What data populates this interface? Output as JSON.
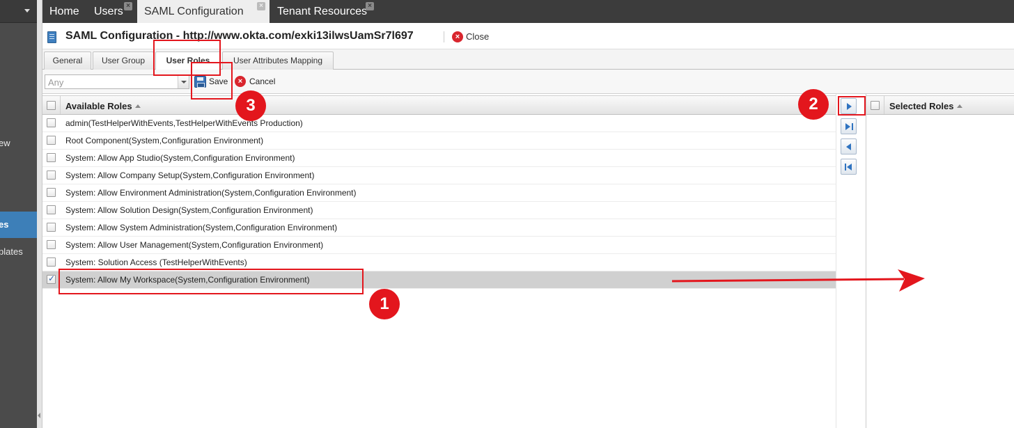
{
  "sidebar": {
    "items": [
      {
        "label": "ew"
      },
      {
        "label": "es"
      },
      {
        "label": "plates"
      }
    ]
  },
  "top_tabs": [
    {
      "label": "Home",
      "closable": false
    },
    {
      "label": "Users",
      "closable": true
    },
    {
      "label": "SAML Configuration",
      "closable": true,
      "active": true
    },
    {
      "label": "Tenant Resources",
      "closable": true
    }
  ],
  "page": {
    "title": "SAML Configuration - http://www.okta.com/exki13ilwsUamSr7l697",
    "close_label": "Close"
  },
  "sub_tabs": [
    {
      "label": "General"
    },
    {
      "label": "User Group"
    },
    {
      "label": "User Roles",
      "active": true
    },
    {
      "label": "User Attributes Mapping"
    }
  ],
  "toolbar": {
    "filter_value": "Any",
    "save_label": "Save",
    "cancel_label": "Cancel"
  },
  "available_roles": {
    "header": "Available Roles",
    "rows": [
      {
        "label": "admin(TestHelperWithEvents,TestHelperWithEvents Production)",
        "checked": false
      },
      {
        "label": "Root Component(System,Configuration Environment)",
        "checked": false
      },
      {
        "label": "System: Allow App Studio(System,Configuration Environment)",
        "checked": false
      },
      {
        "label": "System: Allow Company Setup(System,Configuration Environment)",
        "checked": false
      },
      {
        "label": "System: Allow Environment Administration(System,Configuration Environment)",
        "checked": false
      },
      {
        "label": "System: Allow Solution Design(System,Configuration Environment)",
        "checked": false
      },
      {
        "label": "System: Allow System Administration(System,Configuration Environment)",
        "checked": false
      },
      {
        "label": "System: Allow User Management(System,Configuration Environment)",
        "checked": false
      },
      {
        "label": "System: Solution Access (TestHelperWithEvents)",
        "checked": false
      },
      {
        "label": "System: Allow My Workspace(System,Configuration Environment)",
        "checked": true
      }
    ]
  },
  "selected_roles": {
    "header": "Selected Roles"
  },
  "annotations": {
    "step1": "1",
    "step2": "2",
    "step3": "3",
    "color": "#e3161d"
  }
}
